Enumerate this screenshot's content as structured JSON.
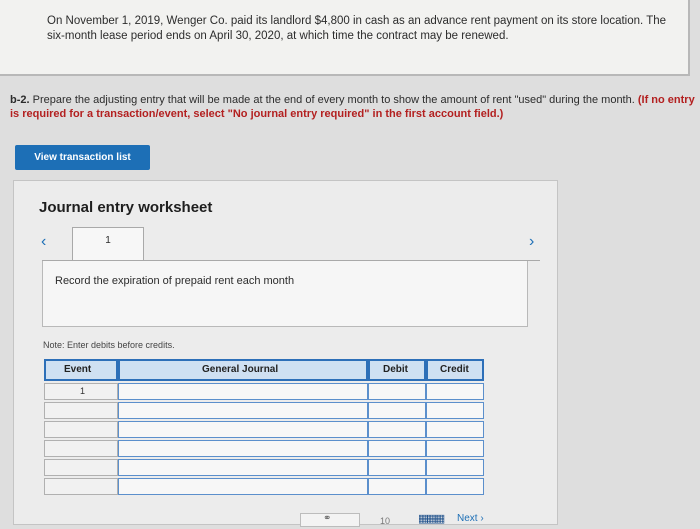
{
  "problem": {
    "text": "On November 1, 2019, Wenger Co. paid its landlord $4,800 in cash as an advance rent payment on its store location. The six-month lease period ends on April 30, 2020, at which time the contract may be renewed."
  },
  "instruction": {
    "label": "b-2.",
    "text": "Prepare the adjusting entry that will be made at the end of every month to show the amount of rent \"used\" during the month.",
    "note": "(If no entry is required for a transaction/event, select \"No journal entry required\" in the first account field.)"
  },
  "view_button": {
    "label": "View transaction list"
  },
  "worksheet": {
    "title": "Journal entry worksheet",
    "prev_icon": "chevron-left-icon",
    "next_icon": "chevron-right-icon",
    "tab_label": "1",
    "description": "Record the expiration of prepaid rent each month",
    "note": "Note: Enter debits before credits."
  },
  "journal": {
    "headers": {
      "event": "Event",
      "general_journal": "General Journal",
      "debit": "Debit",
      "credit": "Credit"
    },
    "rows": [
      {
        "event": "1",
        "account": "",
        "debit": "",
        "credit": ""
      },
      {
        "event": "",
        "account": "",
        "debit": "",
        "credit": ""
      },
      {
        "event": "",
        "account": "",
        "debit": "",
        "credit": ""
      },
      {
        "event": "",
        "account": "",
        "debit": "",
        "credit": ""
      },
      {
        "event": "",
        "account": "",
        "debit": "",
        "credit": ""
      },
      {
        "event": "",
        "account": "",
        "debit": "",
        "credit": ""
      }
    ]
  },
  "footer": {
    "page_num": "10",
    "next_label": "Next",
    "link_icon": "link-icon",
    "grid_icon": "grid-icon"
  },
  "colors": {
    "accent": "#1d6fb6",
    "header_bar": "#2d6fb8",
    "warning_text": "#b32020"
  }
}
